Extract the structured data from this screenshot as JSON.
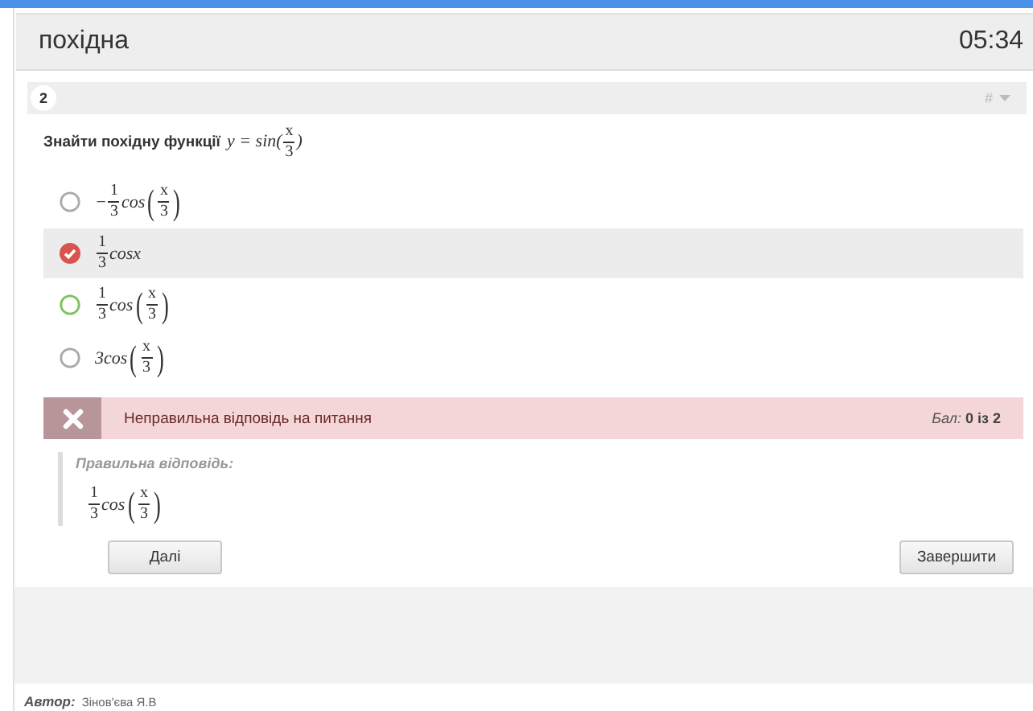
{
  "header": {
    "title": "похідна",
    "timer": "05:34"
  },
  "question": {
    "number": "2",
    "menu_mark": "#",
    "text": "Знайти похідну функції",
    "formula": [
      {
        "kind": "text",
        "text": "y = sin("
      },
      {
        "kind": "frac",
        "num": "x",
        "den": "3"
      },
      {
        "kind": "text",
        "text": ")"
      }
    ]
  },
  "options": [
    {
      "selected": false,
      "correct": false,
      "formula": [
        {
          "kind": "text",
          "text": "−"
        },
        {
          "kind": "frac",
          "num": "1",
          "den": "3"
        },
        {
          "kind": "text",
          "text": "cos"
        },
        {
          "kind": "bigparen",
          "text": "("
        },
        {
          "kind": "frac",
          "num": "x",
          "den": "3"
        },
        {
          "kind": "bigparen",
          "text": ")"
        }
      ]
    },
    {
      "selected": true,
      "correct": false,
      "formula": [
        {
          "kind": "frac",
          "num": "1",
          "den": "3"
        },
        {
          "kind": "text",
          "text": "cosx"
        }
      ]
    },
    {
      "selected": false,
      "correct": true,
      "formula": [
        {
          "kind": "frac",
          "num": "1",
          "den": "3"
        },
        {
          "kind": "text",
          "text": "cos"
        },
        {
          "kind": "bigparen",
          "text": "("
        },
        {
          "kind": "frac",
          "num": "x",
          "den": "3"
        },
        {
          "kind": "bigparen",
          "text": ")"
        }
      ]
    },
    {
      "selected": false,
      "correct": false,
      "formula": [
        {
          "kind": "text",
          "text": "3cos"
        },
        {
          "kind": "bigparen",
          "text": "("
        },
        {
          "kind": "frac",
          "num": "x",
          "den": "3"
        },
        {
          "kind": "bigparen",
          "text": ")"
        }
      ]
    }
  ],
  "feedback": {
    "kind": "incorrect",
    "message": "Неправильна відповідь на питання",
    "score_label": "Бал:",
    "score": "0 із 2"
  },
  "correct_answer": {
    "label": "Правильна відповідь:",
    "formula": [
      {
        "kind": "frac",
        "num": "1",
        "den": "3"
      },
      {
        "kind": "text",
        "text": "cos"
      },
      {
        "kind": "bigparen",
        "text": "("
      },
      {
        "kind": "frac",
        "num": "x",
        "den": "3"
      },
      {
        "kind": "bigparen",
        "text": ")"
      }
    ]
  },
  "buttons": {
    "next": "Далі",
    "finish": "Завершити"
  },
  "footer": {
    "label": "Автор:",
    "author": "Зінов'єва Я.В"
  }
}
